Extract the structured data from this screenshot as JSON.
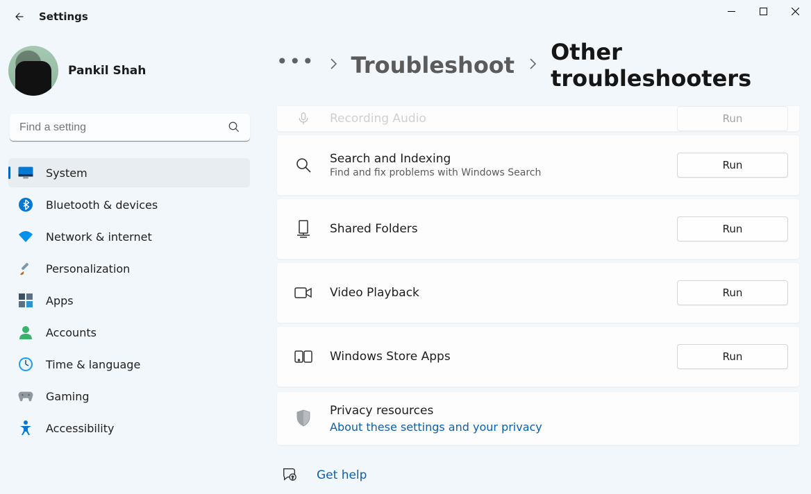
{
  "window_title": "Settings",
  "user_name": "Pankil Shah",
  "search": {
    "placeholder": "Find a setting"
  },
  "nav": {
    "items": [
      {
        "label": "System"
      },
      {
        "label": "Bluetooth & devices"
      },
      {
        "label": "Network & internet"
      },
      {
        "label": "Personalization"
      },
      {
        "label": "Apps"
      },
      {
        "label": "Accounts"
      },
      {
        "label": "Time & language"
      },
      {
        "label": "Gaming"
      },
      {
        "label": "Accessibility"
      }
    ]
  },
  "breadcrumb": {
    "parent": "Troubleshoot",
    "current": "Other troubleshooters"
  },
  "troubleshooters": {
    "cut_item": {
      "title": "Recording Audio",
      "button": "Run"
    },
    "items": [
      {
        "title": "Search and Indexing",
        "subtitle": "Find and fix problems with Windows Search",
        "button": "Run"
      },
      {
        "title": "Shared Folders",
        "button": "Run"
      },
      {
        "title": "Video Playback",
        "button": "Run"
      },
      {
        "title": "Windows Store Apps",
        "button": "Run"
      }
    ]
  },
  "privacy": {
    "title": "Privacy resources",
    "link": "About these settings and your privacy"
  },
  "help": {
    "label": "Get help"
  }
}
